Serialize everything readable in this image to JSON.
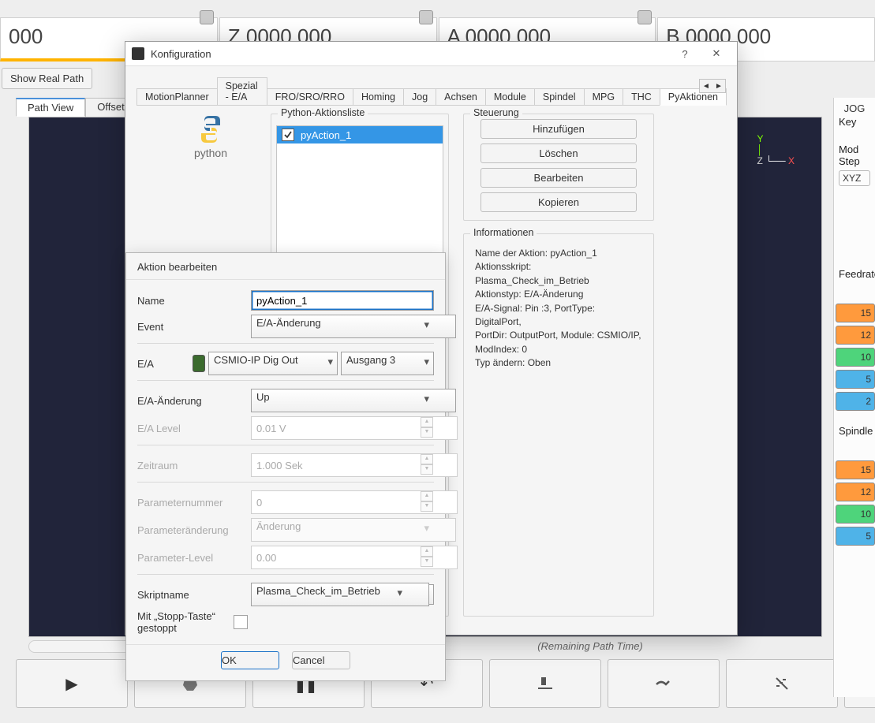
{
  "dro": {
    "x": "000",
    "z": "Z 0000.000",
    "a": "A 0000.000",
    "b": "B 0000.000"
  },
  "buttons": {
    "show_real_path": "Show Real Path"
  },
  "path_tabs": {
    "path_view": "Path View",
    "offsets": "Offsets"
  },
  "path_time": {
    "remaining": "(Remaining Path Time)"
  },
  "right": {
    "heading": "JOG",
    "key": "Key",
    "mode": "Mod",
    "step": "Step",
    "xyz": "XYZ",
    "feedrate_heading": "Feedrate",
    "spindle_heading": "Spindle",
    "feed_vals": [
      "15",
      "12",
      "10",
      "5",
      "2"
    ],
    "spindle_vals": [
      "15",
      "12",
      "10",
      "5"
    ]
  },
  "dialog": {
    "title": "Konfiguration",
    "tabs": [
      "MotionPlanner",
      "Spezial - E/A",
      "FRO/SRO/RRO",
      "Homing",
      "Jog",
      "Achsen",
      "Module",
      "Spindel",
      "MPG",
      "THC",
      "PyAktionen"
    ],
    "active_tab": "PyAktionen",
    "list": {
      "title": "Python-Aktionsliste",
      "items": [
        "pyAction_1"
      ]
    },
    "ctrl": {
      "title": "Steuerung",
      "add": "Hinzufügen",
      "del": "Löschen",
      "edit": "Bearbeiten",
      "copy": "Kopieren"
    },
    "info": {
      "title": "Informationen",
      "l1": "Name der Aktion: pyAction_1",
      "l2": "Aktionsskript: Plasma_Check_im_Betrieb",
      "l3": "Aktionstyp: E/A-Änderung",
      "l4": "E/A-Signal: Pin :3, PortType: DigitalPort,",
      "l5": "PortDir: OutputPort, Module: CSMIO/IP,",
      "l6": "ModIndex: 0",
      "l7": "Typ ändern: Oben"
    }
  },
  "editdlg": {
    "title": "Aktion bearbeiten",
    "name_label": "Name",
    "name_value": "pyAction_1",
    "event_label": "Event",
    "event_value": "E/A-Änderung",
    "ea_label": "E/A",
    "ea_device": "CSMIO-IP  Dig Out",
    "ea_output": "Ausgang 3",
    "eachange_label": "E/A-Änderung",
    "eachange_value": "Up",
    "ealevel_label": "E/A Level",
    "ealevel_value": "0.01 V",
    "period_label": "Zeitraum",
    "period_value": "1.000 Sek",
    "pnum_label": "Parameternummer",
    "pnum_value": "0",
    "pchg_label": "Parameteränderung",
    "pchg_value": "Änderung",
    "plvl_label": "Parameter-Level",
    "plvl_value": "0.00",
    "script_label": "Skriptname",
    "script_value": "Plasma_Check_im_Betrieb",
    "stop_label": "Mit „Stopp-Taste“ gestoppt",
    "ok": "OK",
    "cancel": "Cancel"
  },
  "pylogo_text": "python"
}
